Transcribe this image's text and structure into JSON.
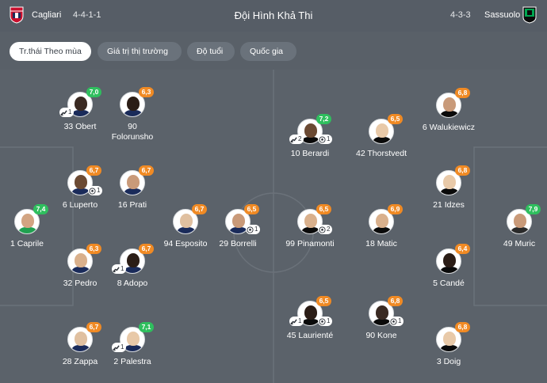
{
  "header": {
    "title": "Đội Hình Khả Thi",
    "home": {
      "name": "Cagliari",
      "formation": "4-4-1-1",
      "logo_icon": "cagliari-crest-icon"
    },
    "away": {
      "name": "Sassuolo",
      "formation": "4-3-3",
      "logo_icon": "sassuolo-crest-icon"
    }
  },
  "tabs": [
    {
      "label": "Tr.thái Theo mùa",
      "active": true
    },
    {
      "label": "Giá trị thị trường",
      "active": false
    },
    {
      "label": "Độ tuổi",
      "active": false
    },
    {
      "label": "Quốc gia",
      "active": false
    }
  ],
  "colors": {
    "rating_green": "#2fbf5e",
    "rating_orange": "#f08a24",
    "pitch": "#5b626a"
  },
  "players": [
    {
      "name": "33 Obert",
      "rating": "7,0",
      "rating_color": "green",
      "assists": "1",
      "goals": ""
    },
    {
      "name": "90\nFolorunsho",
      "rating": "6,3",
      "rating_color": "orange",
      "assists": "",
      "goals": ""
    },
    {
      "name": "6 Luperto",
      "rating": "6,7",
      "rating_color": "orange",
      "assists": "",
      "goals": "1"
    },
    {
      "name": "16 Prati",
      "rating": "6,7",
      "rating_color": "orange",
      "assists": "",
      "goals": ""
    },
    {
      "name": "1 Caprile",
      "rating": "7,4",
      "rating_color": "green",
      "assists": "",
      "goals": ""
    },
    {
      "name": "94 Esposito",
      "rating": "6,7",
      "rating_color": "orange",
      "assists": "",
      "goals": ""
    },
    {
      "name": "29 Borrelli",
      "rating": "6,5",
      "rating_color": "orange",
      "assists": "",
      "goals": "1"
    },
    {
      "name": "32 Pedro",
      "rating": "6,3",
      "rating_color": "orange",
      "assists": "",
      "goals": ""
    },
    {
      "name": "8 Adopo",
      "rating": "6,7",
      "rating_color": "orange",
      "assists": "1",
      "goals": ""
    },
    {
      "name": "28 Zappa",
      "rating": "6,7",
      "rating_color": "orange",
      "assists": "",
      "goals": ""
    },
    {
      "name": "2 Palestra",
      "rating": "7,1",
      "rating_color": "green",
      "assists": "1",
      "goals": ""
    },
    {
      "name": "6 Walukiewicz",
      "rating": "6,8",
      "rating_color": "orange",
      "assists": "",
      "goals": ""
    },
    {
      "name": "10 Berardi",
      "rating": "7,2",
      "rating_color": "green",
      "assists": "2",
      "goals": "1"
    },
    {
      "name": "42 Thorstvedt",
      "rating": "6,5",
      "rating_color": "orange",
      "assists": "",
      "goals": ""
    },
    {
      "name": "21 Idzes",
      "rating": "6,8",
      "rating_color": "orange",
      "assists": "",
      "goals": ""
    },
    {
      "name": "99 Pinamonti",
      "rating": "6,5",
      "rating_color": "orange",
      "assists": "",
      "goals": "2"
    },
    {
      "name": "18 Matic",
      "rating": "6,9",
      "rating_color": "orange",
      "assists": "",
      "goals": ""
    },
    {
      "name": "49 Muric",
      "rating": "7,9",
      "rating_color": "green",
      "assists": "",
      "goals": ""
    },
    {
      "name": "5 Candé",
      "rating": "6,4",
      "rating_color": "orange",
      "assists": "",
      "goals": ""
    },
    {
      "name": "45 Laurienté",
      "rating": "6,5",
      "rating_color": "orange",
      "assists": "1",
      "goals": "1"
    },
    {
      "name": "90 Kone",
      "rating": "6,8",
      "rating_color": "orange",
      "assists": "",
      "goals": "1"
    },
    {
      "name": "3 Doig",
      "rating": "6,8",
      "rating_color": "orange",
      "assists": "",
      "goals": ""
    }
  ]
}
